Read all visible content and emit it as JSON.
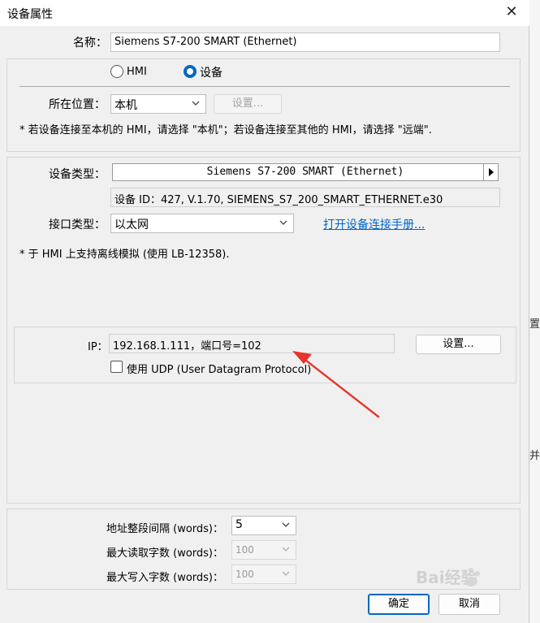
{
  "window": {
    "title": "设备属性",
    "close_glyph": "✕"
  },
  "name_row": {
    "label": "名称：",
    "value": "Siemens S7-200 SMART (Ethernet)"
  },
  "mode": {
    "options": [
      "HMI",
      "设备"
    ],
    "selected": "设备"
  },
  "location": {
    "label": "所在位置：",
    "value": "本机",
    "settings_button": "设置...",
    "note": "* 若设备连接至本机的 HMI，请选择 \"本机\"；若设备连接至其他的 HMI，请选择 \"远端\"."
  },
  "device_type": {
    "label": "设备类型：",
    "value": "Siemens S7-200 SMART (Ethernet)",
    "info": "设备 ID：427, V.1.70, SIEMENS_S7_200_SMART_ETHERNET.e30"
  },
  "interface": {
    "label": "接口类型：",
    "value": "以太网",
    "manual_link": "打开设备连接手册..."
  },
  "offline_note": "* 于 HMI 上支持离线模拟 (使用 LB-12358).",
  "ip": {
    "label": "IP：",
    "value": "192.168.1.111，端口号=102",
    "settings_button": "设置...",
    "udp_checkbox": "使用 UDP (User Datagram Protocol)",
    "udp_checked": false
  },
  "addressing": {
    "gap_label": "地址整段间隔 (words)：",
    "gap_value": "5",
    "max_read_label": "最大读取字数 (words)：",
    "max_read_value": "100",
    "max_write_label": "最大写入字数 (words)：",
    "max_write_value": "100"
  },
  "footer": {
    "ok": "确定",
    "cancel": "取消"
  },
  "background_fragments": {
    "frag1": "置.",
    "frag2": "并"
  },
  "annotation": {
    "arrow_color": "#e8342a"
  },
  "watermark": {
    "text": "Bai经验"
  }
}
